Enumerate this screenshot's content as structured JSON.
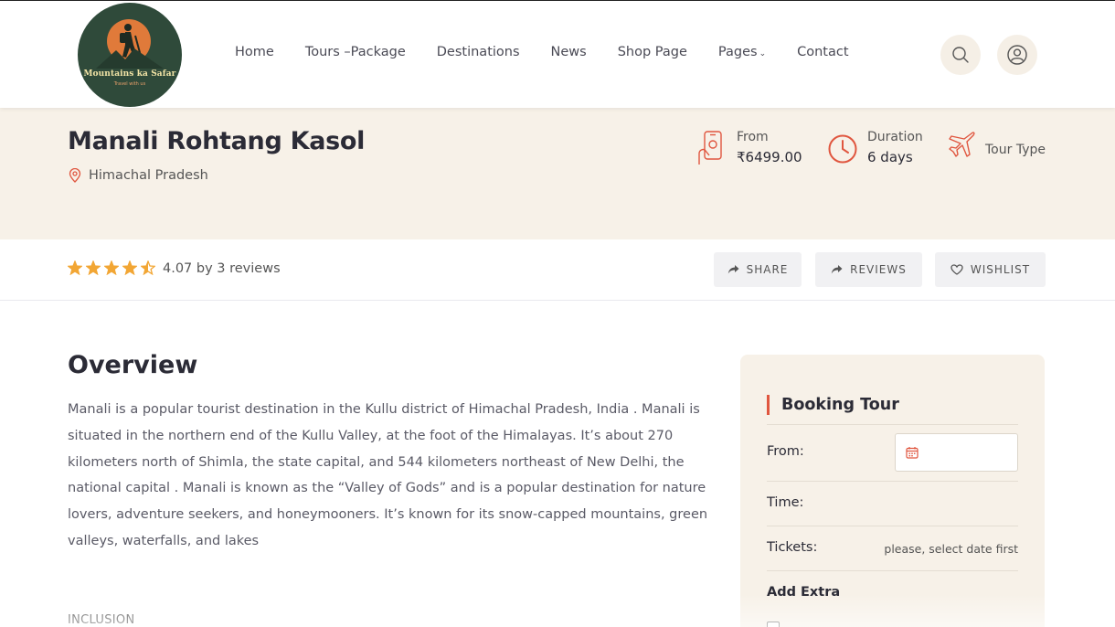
{
  "header": {
    "logo_brand": "Mountains ka Safar",
    "logo_tagline": "Travel with us",
    "nav": [
      {
        "label": "Home"
      },
      {
        "label": "Tours –Package"
      },
      {
        "label": "Destinations"
      },
      {
        "label": "News"
      },
      {
        "label": "Shop Page"
      },
      {
        "label": "Pages"
      },
      {
        "label": "Contact"
      }
    ],
    "icons": {
      "search": "search-icon",
      "user": "user-icon",
      "pages_caret": "chevron-down-icon"
    }
  },
  "tour": {
    "title": "Manali Rohtang Kasol",
    "location": "Himachal Pradesh",
    "from_label": "From",
    "price": "₹6499.00",
    "duration_label": "Duration",
    "duration": "6 days",
    "tour_type_label": "Tour Type"
  },
  "rating": {
    "stars_value": 4.5,
    "stars_max": 5,
    "text": "4.07 by 3 reviews"
  },
  "actions": {
    "share": "SHARE",
    "reviews": "REVIEWS",
    "wishlist": "WISHLIST"
  },
  "overview": {
    "title": "Overview",
    "body": "Manali is a popular tourist destination in the Kullu district of Himachal Pradesh, India . Manali is situated in the northern end of the Kullu Valley, at the foot of the Himalayas. It’s about 270 kilometers north of Shimla, the state capital, and 544 kilometers northeast of New Delhi, the national capital . Manali is known as the “Valley of Gods” and is a popular destination for nature lovers, adventure seekers, and honeymooners. It’s known for its snow-capped mountains, green valleys, waterfalls, and lakes",
    "inclusion_label": "INCLUSION"
  },
  "booking": {
    "title": "Booking Tour",
    "from_label": "From:",
    "time_label": "Time:",
    "tickets_label": "Tickets:",
    "tickets_note": "please, select date first",
    "add_extra": "Add Extra"
  },
  "colors": {
    "accent": "#e0563f",
    "star": "#f2a634",
    "hero_bg": "#f7f1e8",
    "text_dark": "#2b2b36"
  }
}
